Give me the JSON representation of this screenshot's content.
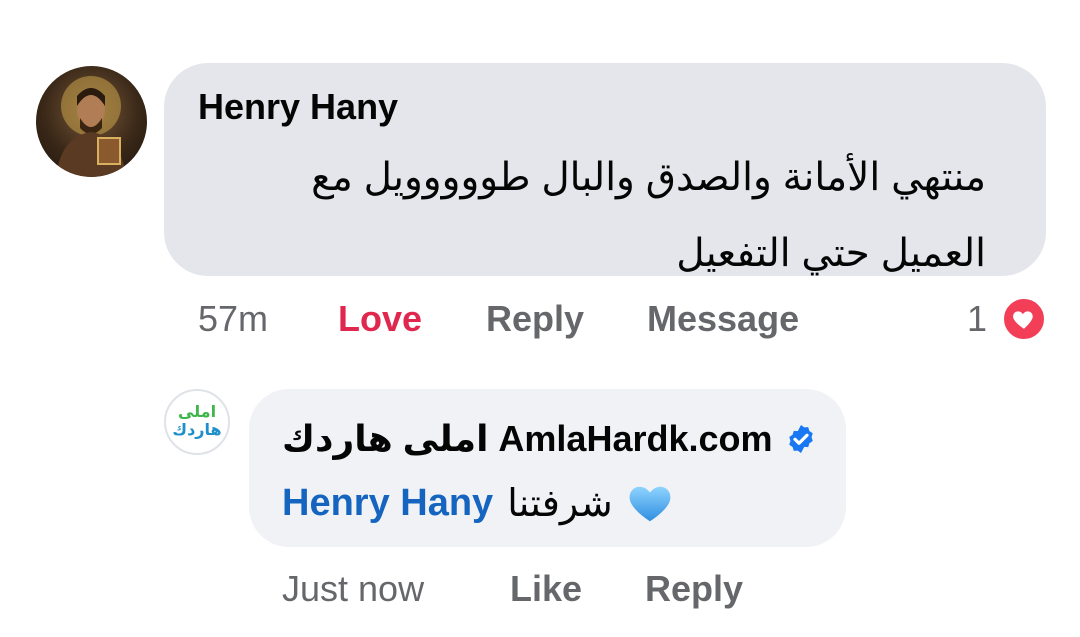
{
  "comment": {
    "author": "Henry Hany",
    "text": "منتهي الأمانة والصدق والبال طووووويل مع العميل حتي التفعيل",
    "time": "57m",
    "actions": {
      "love": "Love",
      "reply": "Reply",
      "message": "Message"
    },
    "reaction_count": "1",
    "reaction_icon": "heart-icon",
    "love_color": "#e0284f"
  },
  "reply": {
    "author": "املى هاردك AmlaHardk.com",
    "verified_icon": "verified-badge-icon",
    "logo_line1": "املى",
    "logo_line2": "هاردك",
    "mention": "Henry Hany",
    "text": "شرفتنا",
    "emoji": "blue-heart-icon",
    "time": "Just now",
    "actions": {
      "like": "Like",
      "reply": "Reply"
    },
    "mention_color": "#1565c0"
  }
}
